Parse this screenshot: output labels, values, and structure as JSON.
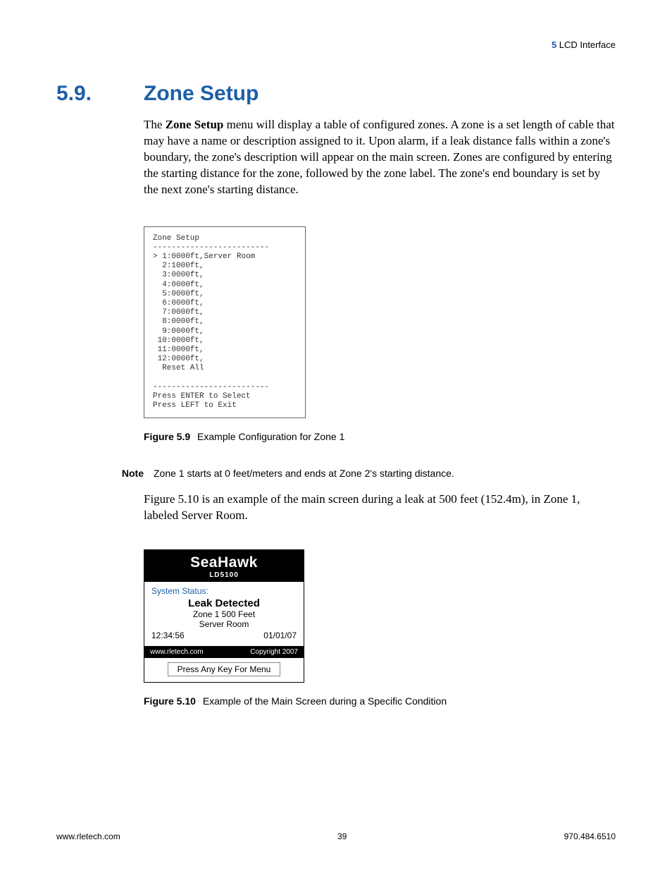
{
  "header": {
    "chapter_num": "5",
    "chapter_title": "LCD Interface"
  },
  "section": {
    "number": "5.9.",
    "title": "Zone Setup"
  },
  "para1": {
    "lead": "The ",
    "bold": "Zone Setup",
    "rest": " menu will display a table of configured zones. A zone is a set length of cable that may have a name or description assigned to it. Upon alarm, if a leak distance falls within a zone's boundary, the zone's description will appear on the main screen. Zones are configured by entering the starting distance for the zone, followed by the zone label. The zone's end boundary is set by the next zone's starting distance."
  },
  "fig59_screen": {
    "title": "Zone Setup",
    "rule": "-------------------------",
    "lines": [
      "> 1:0000ft,Server Room",
      "  2:1000ft,",
      "  3:0000ft,",
      "  4:0000ft,",
      "  5:0000ft,",
      "  6:0000ft,",
      "  7:0000ft,",
      "  8:0000ft,",
      "  9:0000ft,",
      " 10:0000ft,",
      " 11:0000ft,",
      " 12:0000ft,",
      "  Reset All"
    ],
    "footer1": "Press ENTER to Select",
    "footer2": "Press LEFT to Exit"
  },
  "fig59_caption": {
    "label": "Figure 5.9",
    "text": "Example Configuration for Zone 1"
  },
  "note": {
    "label": "Note",
    "text": "Zone 1 starts at 0 feet/meters and ends at Zone 2's starting distance."
  },
  "para2": "Figure 5.10 is an example of the main screen during a leak at 500 feet (152.4m), in Zone 1, labeled Server Room.",
  "device": {
    "brand": "SeaHawk",
    "model": "LD5100",
    "system_status_label": "System Status:",
    "alert": "Leak Detected",
    "zone_line": "Zone 1  500 Feet",
    "room": "Server Room",
    "time": "12:34:56",
    "date": "01/01/07",
    "url": "www.rletech.com",
    "copyright": "Copyright 2007",
    "menu_hint": "Press Any Key For Menu"
  },
  "fig510_caption": {
    "label": "Figure 5.10",
    "text": "Example of the Main Screen during a Specific Condition"
  },
  "footer": {
    "left": "www.rletech.com",
    "center": "39",
    "right": "970.484.6510"
  }
}
